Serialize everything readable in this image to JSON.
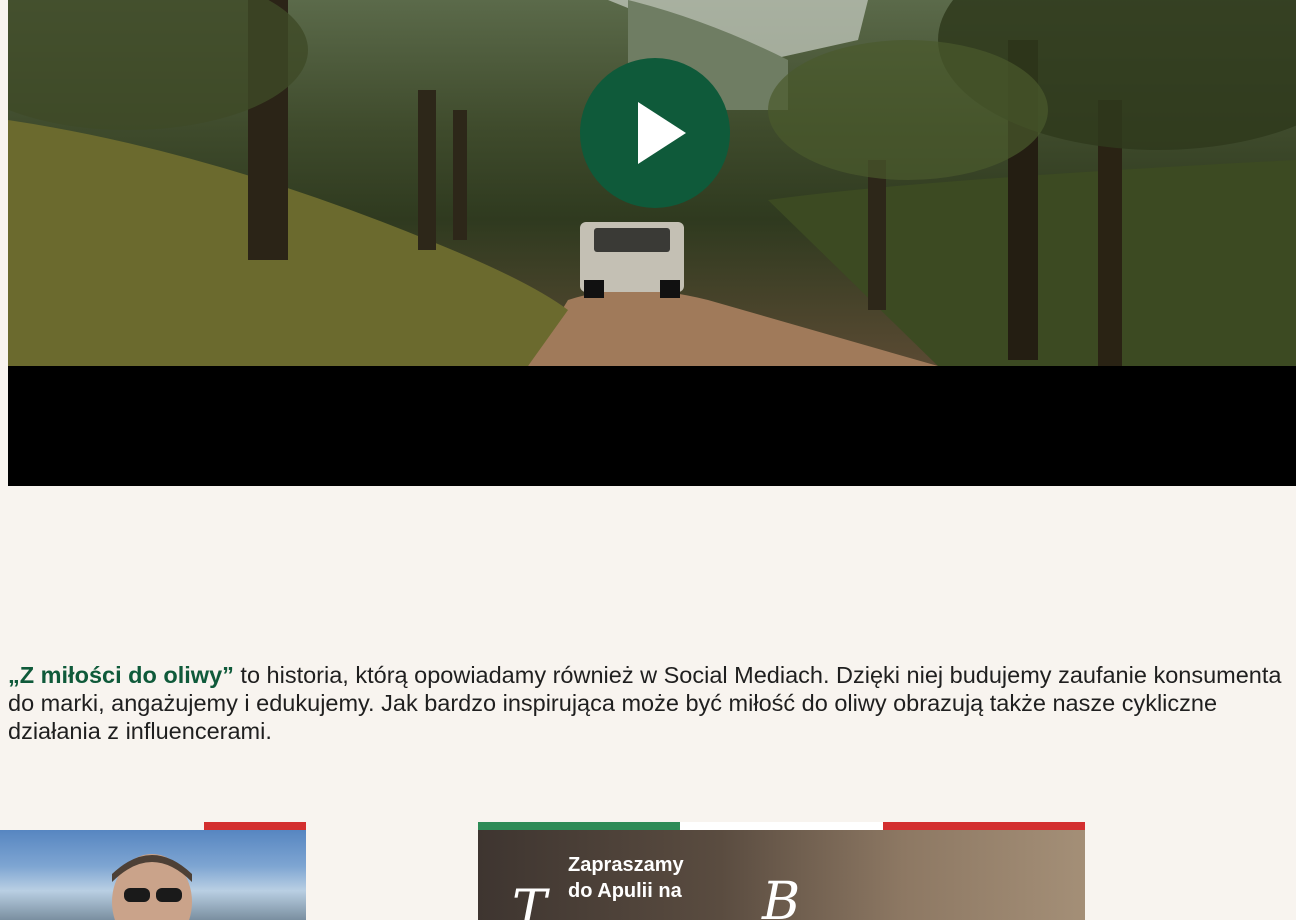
{
  "video": {
    "play_icon": "play-icon"
  },
  "intro": {
    "highlight": "„Z miłości do oliwy”",
    "rest": " to historia, którą opowiadamy również w Social Mediach. Dzięki niej budujemy zaufanie konsumenta do marki, angażujemy i edukujemy. Jak bardzo inspirująca może być miłość do oliwy obrazują także nasze cykliczne działania z influencerami."
  },
  "cards": {
    "card2": {
      "line1": "Zapraszamy",
      "line2": "do Apulii na",
      "script_left": "T",
      "script_right": "B"
    }
  },
  "colors": {
    "brand_green": "#0f5a3a",
    "flag_green": "#2e8b57",
    "flag_white": "#ffffff",
    "flag_red": "#d32f2f"
  }
}
